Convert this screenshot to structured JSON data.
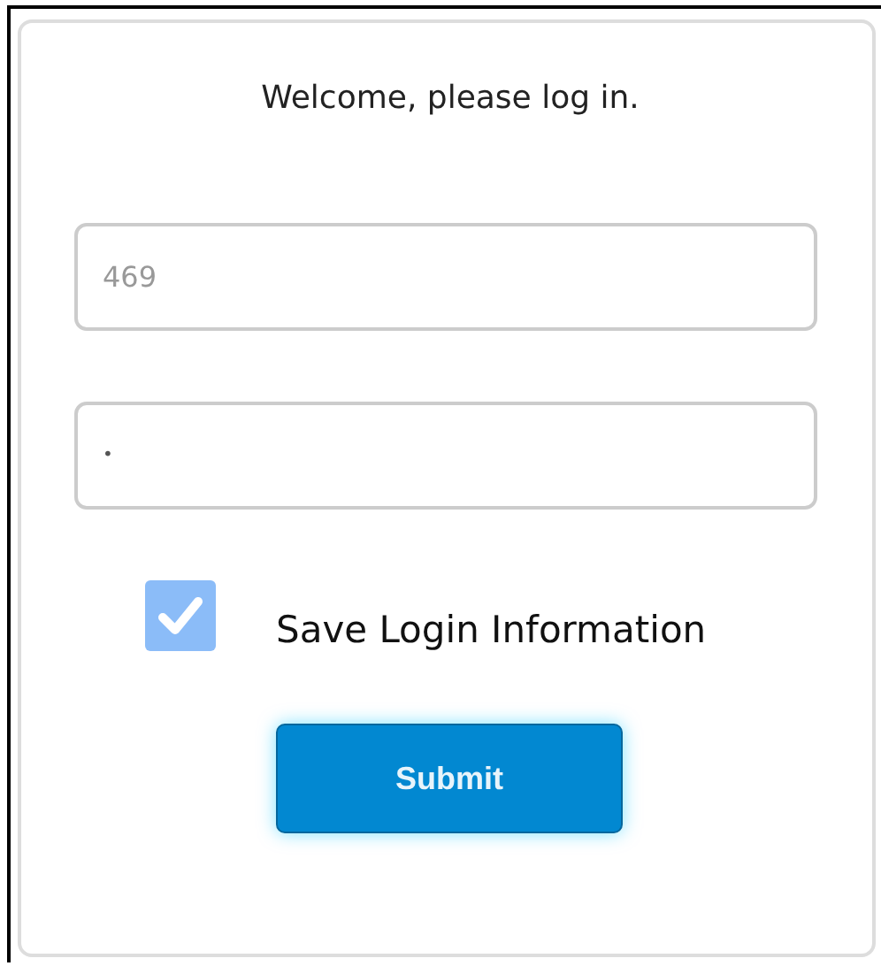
{
  "title": "Welcome, please log in.",
  "fields": [
    {
      "kind": "text",
      "placeholder": "469"
    },
    {
      "kind": "password",
      "value": "•"
    }
  ],
  "save_login": {
    "label": "Save Login Information",
    "checked": true
  },
  "submit": {
    "label": "Submit"
  }
}
